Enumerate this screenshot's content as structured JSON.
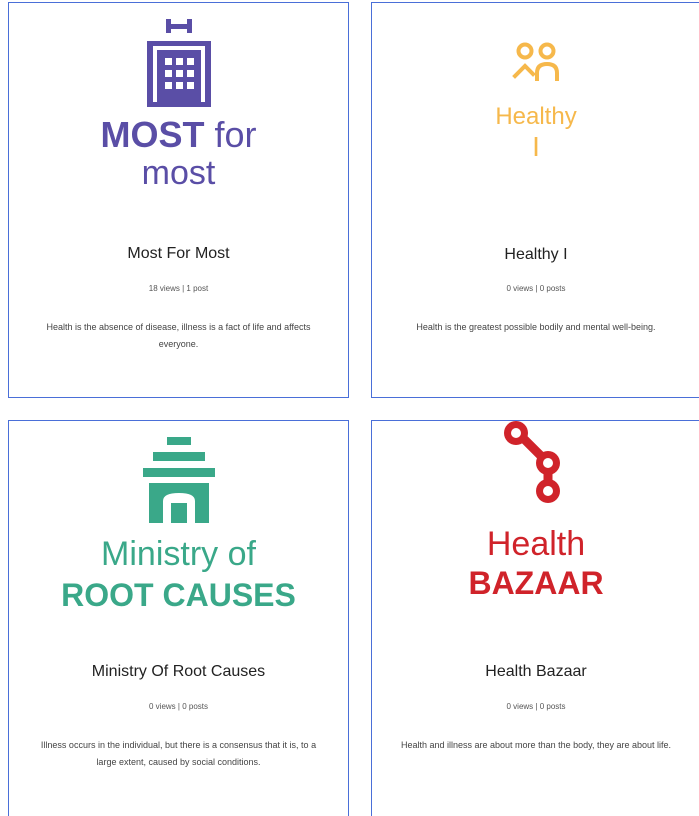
{
  "cards": [
    {
      "title": "Most For Most",
      "stats": "18 views | 1 post",
      "description": "Health is the absence of disease, illness is a fact of life and affects everyone.",
      "logo_line1_bold": "MOST",
      "logo_line1_light": "for",
      "logo_line2": "most",
      "logo_color": "#5a4ea6",
      "logo_icon": "building-icon"
    },
    {
      "title": "Healthy I",
      "stats": "0 views | 0 posts",
      "description": "Health is the greatest possible bodily and mental well-being.",
      "logo_line1": "Healthy",
      "logo_line2": "I",
      "logo_color": "#f6b84b",
      "logo_icon": "two-people-icon"
    },
    {
      "title": "Ministry Of Root Causes",
      "stats": "0 views | 0 posts",
      "description": "Illness occurs in the individual, but there is a consensus that it is, to a large extent, caused by social conditions.",
      "logo_line1": "Ministry of",
      "logo_line2": "ROOT CAUSES",
      "logo_color": "#3aa889",
      "logo_icon": "arch-building-icon"
    },
    {
      "title": "Health Bazaar",
      "stats": "0 views | 0 posts",
      "description": "Health and illness are about more than the body, they are about life.",
      "logo_line1": "Health",
      "logo_line2": "BAZAAR",
      "logo_color": "#d0232a",
      "logo_icon": "connected-nodes-icon"
    }
  ]
}
